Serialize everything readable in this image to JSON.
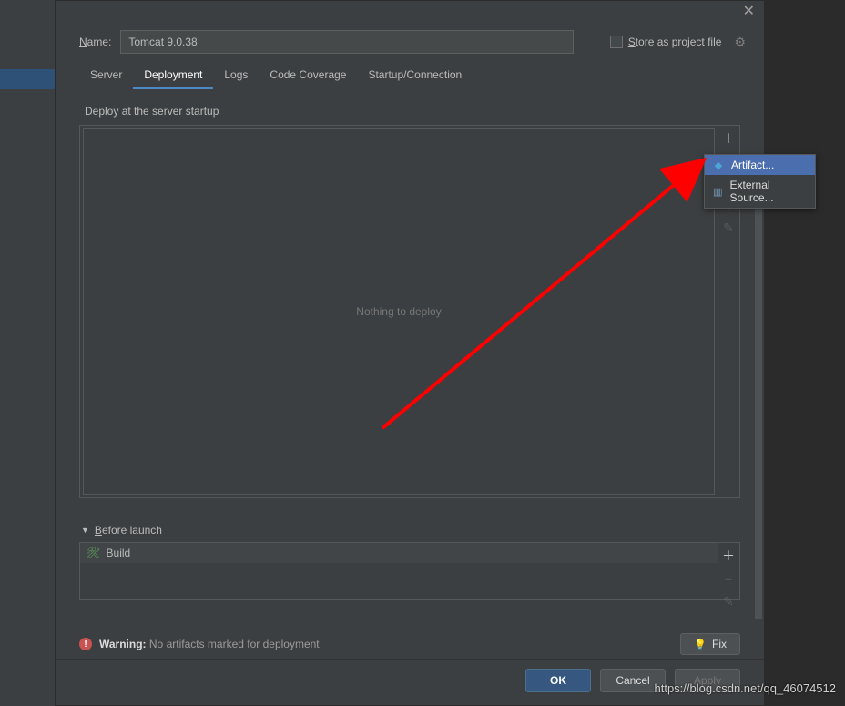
{
  "dialog": {
    "close_tooltip": "Close"
  },
  "header": {
    "name_label_underline": "N",
    "name_label_rest": "ame:",
    "name_value": "Tomcat 9.0.38",
    "store_label_underline": "S",
    "store_label_rest": "tore as project file"
  },
  "tabs": {
    "items": [
      {
        "label": "Server"
      },
      {
        "label": "Deployment"
      },
      {
        "label": "Logs"
      },
      {
        "label": "Code Coverage"
      },
      {
        "label": "Startup/Connection"
      }
    ],
    "active_index": 1
  },
  "deploy": {
    "section_label": "Deploy at the server startup",
    "empty_text": "Nothing to deploy"
  },
  "before_launch": {
    "header_underline": "B",
    "header_rest": "efore launch",
    "items": [
      {
        "label": "Build"
      }
    ]
  },
  "warning": {
    "strong": "Warning:",
    "text": "No artifacts marked for deployment",
    "fix_label": "Fix"
  },
  "footer": {
    "ok": "OK",
    "cancel": "Cancel",
    "apply": "Apply"
  },
  "popup": {
    "items": [
      {
        "label": "Artifact...",
        "selected": true,
        "icon": "art"
      },
      {
        "label": "External Source...",
        "selected": false,
        "icon": "ext"
      }
    ]
  },
  "watermark": "https://blog.csdn.net/qq_46074512"
}
